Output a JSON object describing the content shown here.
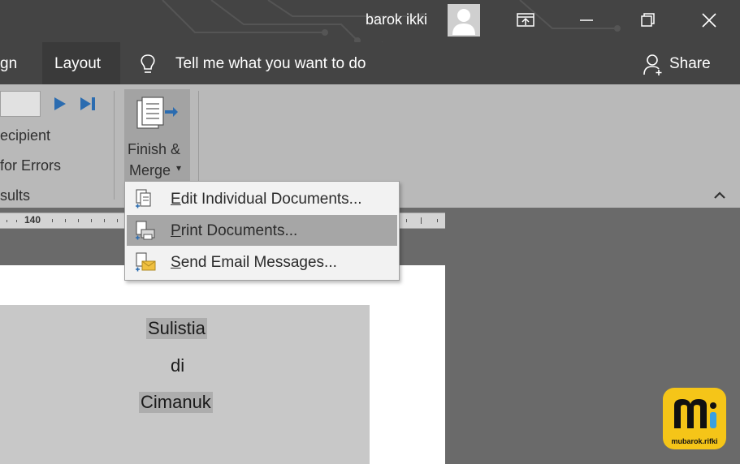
{
  "titlebar": {
    "user_name": "barok ikki",
    "buttons": [
      "ribbon-display-options",
      "minimize",
      "restore",
      "close"
    ]
  },
  "menubar": {
    "tab_partial": "gn",
    "tab_layout": "Layout",
    "tell_me": "Tell me what you want to do",
    "share": "Share"
  },
  "ribbon": {
    "recipient_partial": "ecipient",
    "errors_partial": "for Errors",
    "results_partial": "sults",
    "finish_line1": "Finish &",
    "finish_line2": "Merge",
    "dropdown_arrow": "▾",
    "collapse_arrow": "^"
  },
  "ruler": {
    "label": "140"
  },
  "dropdown": {
    "items": [
      {
        "label": "Edit Individual Documents...",
        "accel": "E"
      },
      {
        "label": "Print Documents...",
        "accel": "P"
      },
      {
        "label": "Send Email Messages...",
        "accel": "S"
      }
    ]
  },
  "document": {
    "lines": [
      "Sulistia",
      "di",
      "Cimanuk"
    ]
  },
  "watermark": {
    "text": "mubarok.rifki",
    "letters": "m"
  },
  "colors": {
    "titlebar": "#444444",
    "ribbon": "#b9b9b9",
    "accent_blue": "#2b6cb0",
    "watermark_yellow": "#f5c518"
  }
}
